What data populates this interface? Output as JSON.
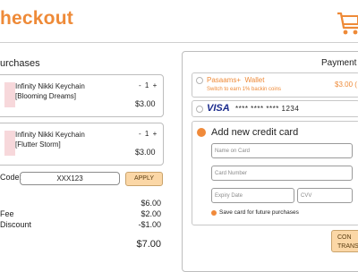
{
  "header": {
    "title": "heckout",
    "cart_icon": "shopping-cart-icon"
  },
  "purchases": {
    "title": "urchases",
    "items": [
      {
        "name_line1": "Infinity Nikki Keychain",
        "name_line2": "[Blooming Dreams]",
        "qty_minus": "-",
        "qty": "1",
        "qty_plus": "+",
        "price": "$3.00"
      },
      {
        "name_line1": "Infinity Nikki Keychain",
        "name_line2": "[Flutter Storm]",
        "qty_minus": "-",
        "qty": "1",
        "qty_plus": "+",
        "price": "$3.00"
      }
    ],
    "code_label": "Code:",
    "code_value": "XXX123",
    "apply_label": "APPLY",
    "summary": [
      {
        "label": "",
        "value": "$6.00"
      },
      {
        "label": "Fee",
        "value": "$2.00"
      },
      {
        "label": "Discount",
        "value": "-$1.00"
      }
    ],
    "total": "$7.00"
  },
  "payment": {
    "title": "Payment",
    "wallet": {
      "name": "Pasaams+",
      "suffix": "Wallet",
      "subtitle": "Switch to earn 1% backin coins",
      "amount": "$3.00 ("
    },
    "saved_card": {
      "brand": "VISA",
      "masked": "**** **** **** 1234"
    },
    "add_card_label": "Add new credit card",
    "fields": {
      "name_placeholder": "Name on Card",
      "number_placeholder": "Card Number",
      "expiry_placeholder": "Expiry Date",
      "cvv_placeholder": "CVV"
    },
    "save_card_label": "Save card for future purchases",
    "confirm_line1": "CON",
    "confirm_line2": "TRANS"
  },
  "colors": {
    "accent": "#ee8a38",
    "button_bg": "#fbd7a6",
    "visa_blue": "#1a2a8c"
  }
}
